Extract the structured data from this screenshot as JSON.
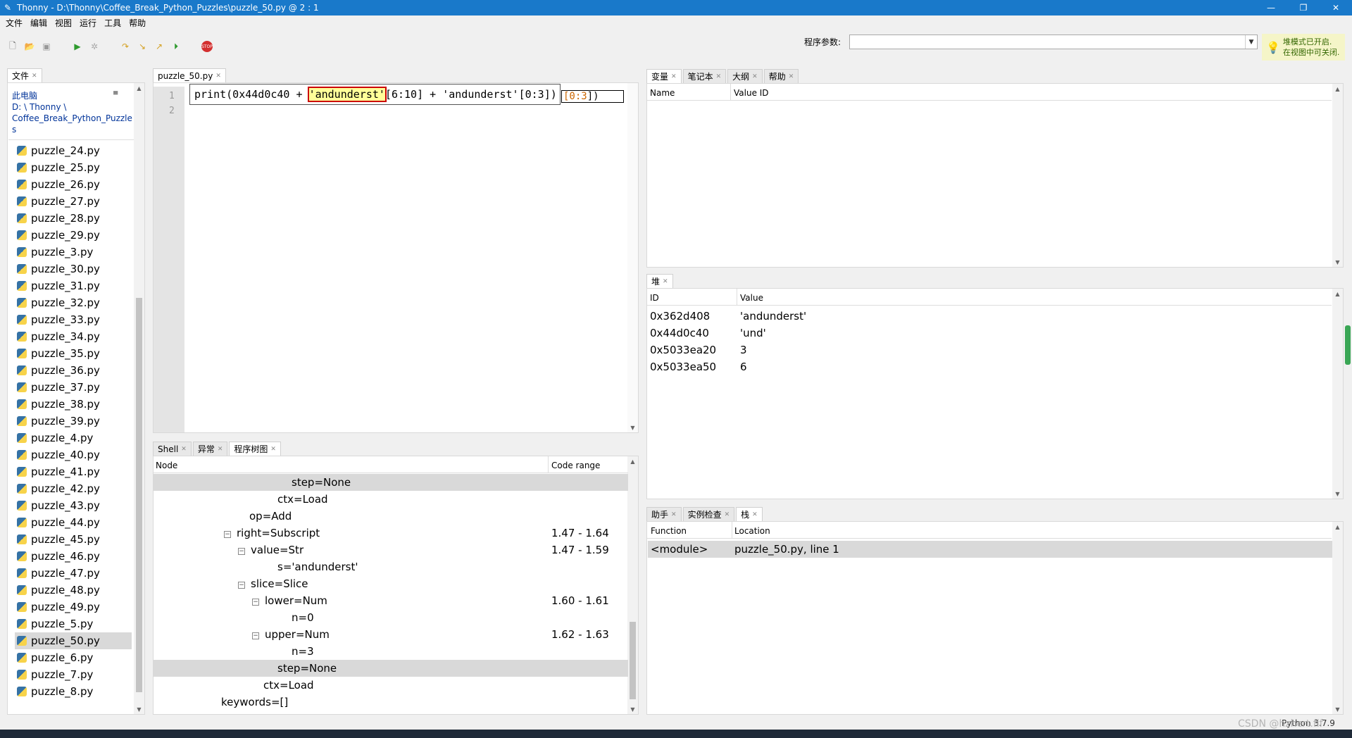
{
  "window": {
    "title": "Thonny  -  D:\\Thonny\\Coffee_Break_Python_Puzzles\\puzzle_50.py  @  2 : 1",
    "minimize_icon": "minimize-icon",
    "maximize_icon": "restore-icon",
    "close_icon": "close-icon"
  },
  "menu": [
    "文件",
    "编辑",
    "视图",
    "运行",
    "工具",
    "帮助"
  ],
  "toolbar": {
    "icons": [
      "new-file-icon",
      "open-file-icon",
      "save-icon",
      "run-icon",
      "debug-icon",
      "step-over-icon",
      "step-into-icon",
      "step-out-icon",
      "resume-icon",
      "stop-icon"
    ],
    "args_label": "程序参数:",
    "args_value": "",
    "hint_line1": "堆模式已开启.",
    "hint_line2": "在视图中可关闭."
  },
  "files": {
    "tab": "文件",
    "computer": "此电脑",
    "path_line1": "D: \\ Thonny \\",
    "path_line2": "Coffee_Break_Python_Puzzle",
    "path_line3": "s",
    "items": [
      "puzzle_24.py",
      "puzzle_25.py",
      "puzzle_26.py",
      "puzzle_27.py",
      "puzzle_28.py",
      "puzzle_29.py",
      "puzzle_3.py",
      "puzzle_30.py",
      "puzzle_31.py",
      "puzzle_32.py",
      "puzzle_33.py",
      "puzzle_34.py",
      "puzzle_35.py",
      "puzzle_36.py",
      "puzzle_37.py",
      "puzzle_38.py",
      "puzzle_39.py",
      "puzzle_4.py",
      "puzzle_40.py",
      "puzzle_41.py",
      "puzzle_42.py",
      "puzzle_43.py",
      "puzzle_44.py",
      "puzzle_45.py",
      "puzzle_46.py",
      "puzzle_47.py",
      "puzzle_48.py",
      "puzzle_49.py",
      "puzzle_5.py",
      "puzzle_50.py",
      "puzzle_6.py",
      "puzzle_7.py",
      "puzzle_8.py"
    ],
    "selected": "puzzle_50.py"
  },
  "editor": {
    "tab": "puzzle_50.py",
    "line1": "1",
    "line2": "2",
    "code_pre": "print(0x44d0c40 + ",
    "code_hl": "'andunderst'",
    "code_post": "[6:10] + 'andunderst'[0:3])",
    "tail_a": "[0:3",
    "tail_b": "])"
  },
  "bottom_tabs": [
    "Shell",
    "异常",
    "程序树图"
  ],
  "tree": {
    "col_node": "Node",
    "col_range": "Code range",
    "rows": [
      {
        "node": "step=None",
        "range": "",
        "sel": true
      },
      {
        "node": "ctx=Load",
        "range": ""
      },
      {
        "node": "op=Add",
        "range": ""
      },
      {
        "node": "right=Subscript",
        "range": "1.47  -  1.64",
        "exp": "⊟"
      },
      {
        "node": "value=Str",
        "range": "1.47  -  1.59",
        "exp": "⊟"
      },
      {
        "node": "s='andunderst'",
        "range": ""
      },
      {
        "node": "slice=Slice",
        "range": "",
        "exp": "⊟"
      },
      {
        "node": "lower=Num",
        "range": "1.60  -  1.61",
        "exp": "⊟"
      },
      {
        "node": "n=0",
        "range": ""
      },
      {
        "node": "upper=Num",
        "range": "1.62  -  1.63",
        "exp": "⊟"
      },
      {
        "node": "n=3",
        "range": ""
      },
      {
        "node": "step=None",
        "range": "",
        "sel": true
      },
      {
        "node": "ctx=Load",
        "range": ""
      },
      {
        "node": "keywords=[]",
        "range": ""
      }
    ]
  },
  "vars": {
    "tabs": [
      "变量",
      "笔记本",
      "大纲",
      "帮助"
    ],
    "col_name": "Name",
    "col_value": "Value ID"
  },
  "heap": {
    "tab": "堆",
    "col_id": "ID",
    "col_value": "Value",
    "rows": [
      {
        "id": "0x362d408",
        "value": "'andunderst'"
      },
      {
        "id": "0x44d0c40",
        "value": "'und'"
      },
      {
        "id": "0x5033ea20",
        "value": "3"
      },
      {
        "id": "0x5033ea50",
        "value": "6"
      }
    ]
  },
  "stack": {
    "tabs": [
      "助手",
      "实例检查",
      "栈"
    ],
    "col_function": "Function",
    "col_location": "Location",
    "rows": [
      {
        "function": "<module>",
        "location": "puzzle_50.py, line 1"
      }
    ]
  },
  "status": {
    "watermark": "CSDN @hzhcrt.fif",
    "python_version": "Python 3.7.9"
  }
}
